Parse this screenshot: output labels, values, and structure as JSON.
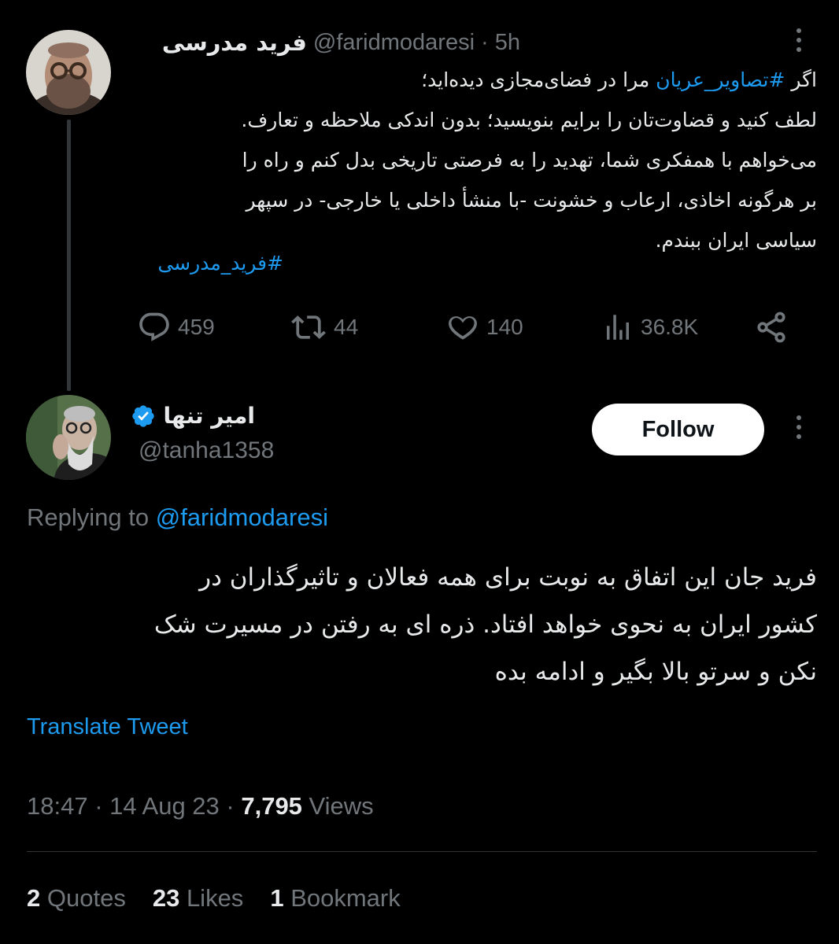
{
  "tweet1": {
    "author_name": "فرید مدرسی",
    "handle": "@faridmodaresi",
    "time": "· 5h",
    "line1_pre": "اگر ",
    "line1_hashtag": "#تصاویر_عریان",
    "line1_post": " مرا در فضای‌مجازی دیده‌اید؛",
    "lines_rest": "لطف کنید و قضاوت‌تان را برایم بنویسید؛ بدون اندکی ملاحظه و تعارف.\nمی‌خواهم با همفکری شما، تهدید را به فرصتی تاریخی بدل کنم و راه را\nبر هرگونه اخاذی، ارعاب و خشونت -با منشأ داخلی یا خارجی- در سپهر\nسیاسی ایران ببندم.",
    "hashtag_footer": "#فرید_مدرسی",
    "replies": "459",
    "retweets": "44",
    "likes": "140",
    "views": "36.8K"
  },
  "tweet2": {
    "author_name": "امیر تنها",
    "handle": "@tanha1358",
    "follow_label": "Follow",
    "replying_label": "Replying to ",
    "replying_handle": "@faridmodaresi",
    "body": "فرید جان این اتفاق به نوبت برای همه فعالان و تاثیرگذاران در\nکشور ایران به نحوی خواهد افتاد. ذره ای به رفتن در مسیرت شک\nنکن و سرتو بالا بگیر و ادامه بده",
    "translate_label": "Translate Tweet",
    "time": "18:47",
    "date": "14 Aug 23",
    "views_count": "7,795",
    "views_label": "Views",
    "quotes_count": "2",
    "quotes_label": "Quotes",
    "likes_count": "23",
    "likes_label": "Likes",
    "bookmarks_count": "1",
    "bookmarks_label": "Bookmark"
  },
  "colors": {
    "background": "#000000",
    "text": "#e7e9ea",
    "muted": "#71767b",
    "link": "#1d9bf0",
    "verified": "#1d9bf0"
  },
  "icons": [
    "reply-icon",
    "retweet-icon",
    "like-icon",
    "views-icon",
    "share-icon",
    "more-icon",
    "verified-badge-icon"
  ]
}
